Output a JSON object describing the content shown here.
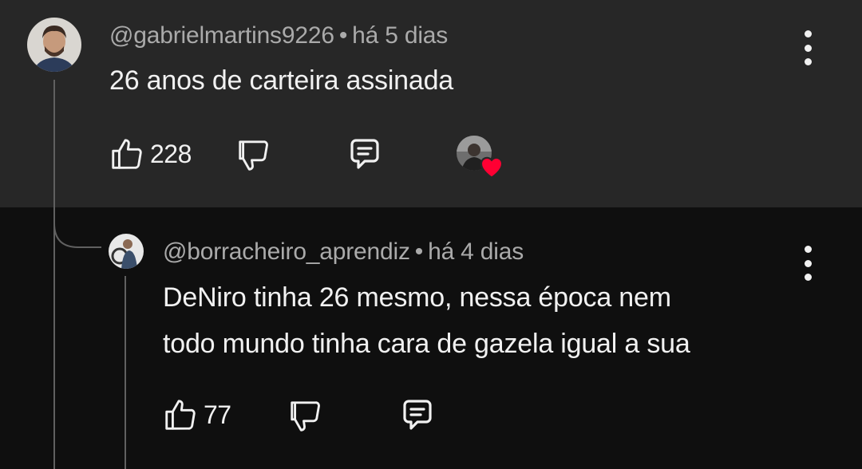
{
  "comments": [
    {
      "handle": "@gabrielmartins9226",
      "separator": "•",
      "time": "há 5 dias",
      "text": "26 anos de carteira assinada",
      "likes": "228",
      "creator_heart": true
    },
    {
      "handle": "@borracheiro_aprendiz",
      "separator": "•",
      "time": "há 4 dias",
      "text_lines": [
        "DeNiro tinha 26 mesmo, nessa época nem",
        "todo mundo tinha cara de gazela igual a sua"
      ],
      "likes": "77"
    }
  ],
  "colors": {
    "top_background": "#272727",
    "reply_background": "#0f0f0f",
    "meta_text": "#aaaaaa",
    "body_text": "#f1f1f1",
    "heart": "#ff0033"
  },
  "icons": [
    "like-icon",
    "dislike-icon",
    "reply-icon",
    "more-options-icon",
    "heart-icon"
  ]
}
